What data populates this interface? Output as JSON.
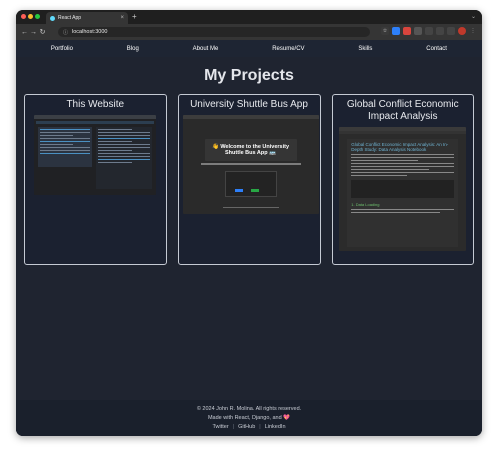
{
  "browser": {
    "tab_title": "React App",
    "tab_close": "×",
    "new_tab": "+",
    "url": "localhost:3000",
    "back": "←",
    "forward": "→",
    "reload": "↻"
  },
  "nav": {
    "items": [
      "Portfolio",
      "Blog",
      "About Me",
      "Resume/CV",
      "Skills",
      "Contact"
    ]
  },
  "main": {
    "title": "My Projects",
    "projects": [
      {
        "title": "This Website"
      },
      {
        "title": "University Shuttle Bus App",
        "preview_heading": "👋 Welcome to the University Shuttle Bus App 🚌"
      },
      {
        "title": "Global Conflict Economic Impact Analysis",
        "preview_heading": "Global Conflict Economic Impact Analysis: An In-Depth Study: Data Analysis Notebook",
        "preview_section": "1. Data Loading"
      }
    ]
  },
  "footer": {
    "copyright": "© 2024 John R. Molina. All rights reserved.",
    "made_with": "Made with React, Django, and 💖",
    "links": [
      "Twitter",
      "GitHub",
      "LinkedIn"
    ],
    "separator": "|"
  },
  "colors": {
    "page_bg": "#1f2430",
    "nav_bg": "#1e2533",
    "card_border": "#c5cad3",
    "footer_bg": "#1a202c"
  }
}
